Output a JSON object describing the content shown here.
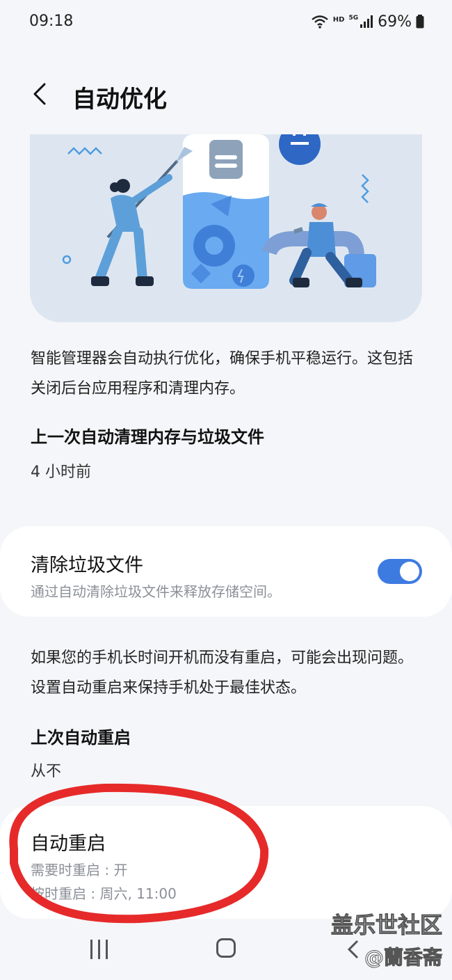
{
  "status": {
    "time": "09:18",
    "hd": "HD",
    "network": "5G",
    "battery": "69%"
  },
  "header": {
    "title": "自动优化",
    "back_icon": "chevron-left-icon"
  },
  "description": "智能管理器会自动执行优化，确保手机平稳运行。这包括关闭后台应用程序和清理内存。",
  "last_clean": {
    "heading": "上一次自动清理内存与垃圾文件",
    "value": "4 小时前"
  },
  "junk_card": {
    "title": "清除垃圾文件",
    "subtitle": "通过自动清除垃圾文件来释放存储空间。",
    "toggle_on": true,
    "accent": "#3e7be0"
  },
  "restart_description": "如果您的手机长时间开机而没有重启，可能会出现问题。设置自动重启来保持手机处于最佳状态。",
  "last_restart": {
    "heading": "上次自动重启",
    "value": "从不"
  },
  "restart_card": {
    "title": "自动重启",
    "line1": "需要时重启 : 开",
    "line2": "按时重启 : 周六, 11:00"
  },
  "watermark": {
    "line1": "盖乐世社区",
    "line2": "@蘭香斋"
  },
  "nav": {
    "recent_icon": "recent-apps-icon",
    "home_icon": "home-icon",
    "back_icon": "back-icon"
  }
}
